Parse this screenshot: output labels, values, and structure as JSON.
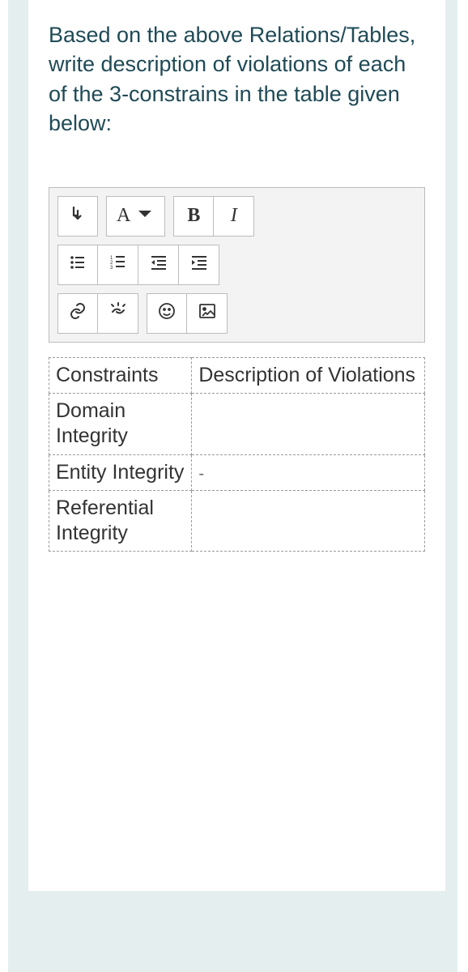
{
  "instruction": "Based on the above Relations/Tables, write description of violations of each of the 3-constrains in the table given below:",
  "toolbar": {
    "font_letter": "A",
    "bold_letter": "B",
    "italic_letter": "I"
  },
  "table": {
    "headers": {
      "constraints": "Constraints",
      "description": "Description of Violations"
    },
    "rows": [
      {
        "name": "Domain Integrity",
        "desc": ""
      },
      {
        "name": "Entity Integrity",
        "desc": "-"
      },
      {
        "name": "Referential Integrity",
        "desc": ""
      }
    ]
  }
}
